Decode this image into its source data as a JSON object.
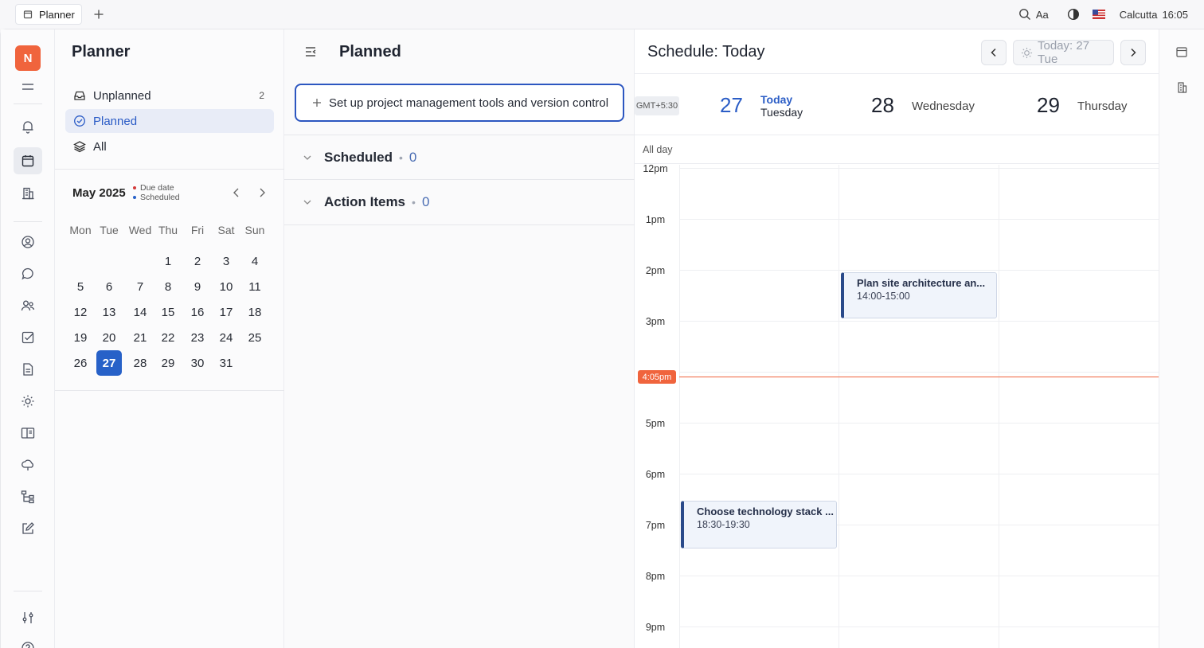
{
  "browser": {
    "tab_label": "Planner",
    "font_toggle": "Aa",
    "location": "Calcutta",
    "time": "16:05"
  },
  "workspace": {
    "avatar_letter": "N"
  },
  "planner": {
    "title": "Planner",
    "nav": [
      {
        "label": "Unplanned",
        "count": "2",
        "icon": "inbox-icon"
      },
      {
        "label": "Planned",
        "icon": "check-circle-icon"
      },
      {
        "label": "All",
        "icon": "layers-icon"
      }
    ],
    "calendar": {
      "month": "May 2025",
      "legend_due": "Due date",
      "legend_scheduled": "Scheduled",
      "weekdays": [
        "Mon",
        "Tue",
        "Wed",
        "Thu",
        "Fri",
        "Sat",
        "Sun"
      ],
      "weeks": [
        [
          "",
          "",
          "",
          "1",
          "2",
          "3",
          "4"
        ],
        [
          "5",
          "6",
          "7",
          "8",
          "9",
          "10",
          "11"
        ],
        [
          "12",
          "13",
          "14",
          "15",
          "16",
          "17",
          "18"
        ],
        [
          "19",
          "20",
          "21",
          "22",
          "23",
          "24",
          "25"
        ],
        [
          "26",
          "27",
          "28",
          "29",
          "30",
          "31",
          ""
        ]
      ],
      "selected_day": "27"
    }
  },
  "planned": {
    "title": "Planned",
    "new_task_text": "Set up project management tools and version control",
    "groups": [
      {
        "title": "Scheduled",
        "count": "0"
      },
      {
        "title": "Action Items",
        "count": "0"
      }
    ]
  },
  "schedule": {
    "title": "Schedule: Today",
    "today_button": "Today: 27 Tue",
    "timezone": "GMT+5:30",
    "all_day_label": "All day",
    "days": [
      {
        "date": "27",
        "today_label": "Today",
        "weekday": "Tuesday"
      },
      {
        "date": "28",
        "weekday": "Wednesday"
      },
      {
        "date": "29",
        "weekday": "Thursday"
      }
    ],
    "hours": [
      "12pm",
      "1pm",
      "2pm",
      "3pm",
      "4pm",
      "5pm",
      "6pm",
      "7pm",
      "8pm",
      "9pm"
    ],
    "now_label": "4:05pm",
    "events": [
      {
        "title": "Plan site architecture an...",
        "time": "14:00-15:00"
      },
      {
        "title": "Choose technology stack ...",
        "time": "18:30-19:30"
      }
    ]
  },
  "colors": {
    "accent": "#2761c8",
    "avatar": "#f0643d",
    "now_line": "#f0643d",
    "due_dot": "#d33a3a",
    "scheduled_dot": "#2761c8"
  }
}
